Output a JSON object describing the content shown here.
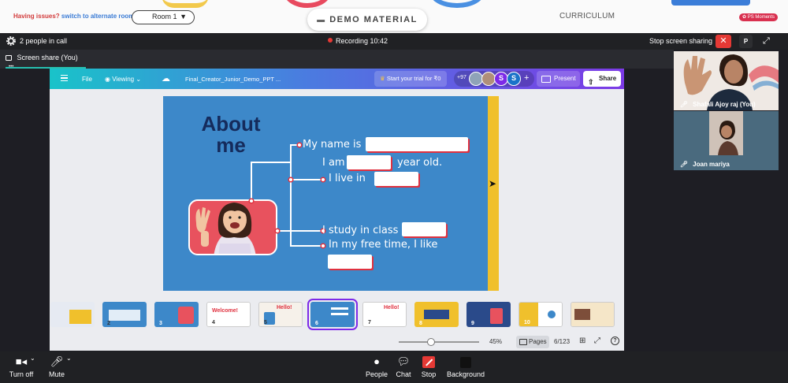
{
  "top": {
    "issue_label": "Having issues?",
    "issue_link": "switch to alternate room",
    "room_value": "Room 1",
    "demo_label": "DEMO MATERIAL",
    "curriculum_label": "CURRICULUM",
    "ps_label": "PS Moments"
  },
  "call": {
    "people": "2 people in call",
    "recording": "Recording 10:42",
    "stop_sharing": "Stop screen sharing",
    "p_label": "P"
  },
  "tab": {
    "label": "Screen share (You)",
    "more": "•••"
  },
  "canva": {
    "file": "File",
    "viewing": "Viewing",
    "filename": "Final_Creator_Junior_Demo_PPT ...",
    "trial": "Start your trial for ₹0",
    "collab_count": "+97",
    "avatars": [
      "S",
      "S"
    ],
    "present": "Present",
    "share": "Share"
  },
  "slide": {
    "title_line1": "About",
    "title_line2": "me",
    "name": "My name is",
    "i_am": "I am",
    "year_old": "year old.",
    "live": "I live in",
    "study": "I study in class",
    "free_time": "In my free time, I like"
  },
  "thumbs": {
    "labels": [
      "",
      "2",
      "3",
      "4",
      "5",
      "6",
      "7",
      "8",
      "9",
      "10",
      "",
      ""
    ],
    "colors": [
      "#e6eaf2",
      "#3d88c9",
      "#3d88c9",
      "#ffffff",
      "#f6f1ea",
      "#3d88c9",
      "#ffffff",
      "#f0c02c",
      "#2a4a8a",
      "#ffffff",
      "#f5e6c8",
      "#ffffff"
    ],
    "hello_1": "Welcome!",
    "hello_2": "Hello!",
    "hello_3": "Hello!"
  },
  "pagebar": {
    "zoom": "45%",
    "zoom_level": 0.45,
    "pages": "Pages",
    "page_count": "6/123"
  },
  "participants": [
    {
      "name": "Shafali Ajoy raj (You)"
    },
    {
      "name": "Joan mariya"
    }
  ],
  "controls": {
    "turn_off": "Turn off",
    "mute": "Mute",
    "people": "People",
    "chat": "Chat",
    "stop": "Stop",
    "background": "Background"
  }
}
